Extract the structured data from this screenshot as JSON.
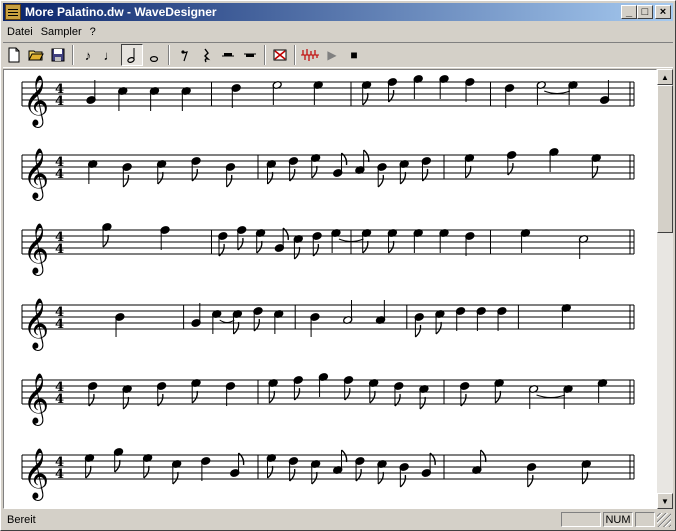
{
  "window": {
    "title": "More Palatino.dw - WaveDesigner"
  },
  "title_buttons": {
    "minimize": "_",
    "maximize": "□",
    "close": "×"
  },
  "menu": [
    {
      "label": "Datei"
    },
    {
      "label": "Sampler"
    },
    {
      "label": "?"
    }
  ],
  "toolbar": {
    "new": "new-file-icon",
    "open": "open-folder-icon",
    "save": "save-disk-icon",
    "eighth_note": "♪",
    "quarter_note": "♩",
    "half_note": "𝅗𝅥",
    "whole_note": "𝅝",
    "eighth_rest": "𝄾",
    "quarter_rest": "𝄽",
    "half_rest": "half-rest-icon",
    "whole_rest": "whole-rest-icon",
    "delete": "delete-note-icon",
    "waveform": "waveform-icon",
    "play": "▶",
    "stop": "■"
  },
  "score": {
    "clef": "𝄞",
    "time_top": "4",
    "time_bottom": "4",
    "rows": [
      {
        "measures": [
          [
            {
              "p": "G4",
              "d": "q"
            },
            {
              "p": "C5",
              "d": "q"
            },
            {
              "p": "C5",
              "d": "q"
            },
            {
              "p": "C5",
              "d": "q"
            }
          ],
          [
            {
              "p": "D5",
              "d": "q"
            },
            {
              "p": "E5",
              "d": "h"
            },
            {
              "p": "E5",
              "d": "q"
            }
          ],
          [
            {
              "p": "E5",
              "d": "e"
            },
            {
              "p": "F5",
              "d": "e"
            },
            {
              "p": "G5",
              "d": "q"
            },
            {
              "p": "G5",
              "d": "q"
            },
            {
              "p": "F5",
              "d": "q"
            }
          ],
          [
            {
              "p": "D5",
              "d": "q"
            },
            {
              "p": "E5",
              "d": "h",
              "tie": true
            },
            {
              "p": "E5",
              "d": "q"
            },
            {
              "p": "G4",
              "d": "q"
            }
          ]
        ]
      },
      {
        "measures": [
          [
            {
              "p": "C5",
              "d": "q"
            },
            {
              "p": "B4",
              "d": "e"
            },
            {
              "p": "C5",
              "d": "e"
            },
            {
              "p": "D5",
              "d": "e"
            },
            {
              "p": "B4",
              "d": "e"
            }
          ],
          [
            {
              "p": "C5",
              "d": "e"
            },
            {
              "p": "D5",
              "d": "e"
            },
            {
              "p": "E5",
              "d": "e"
            },
            {
              "p": "G4",
              "d": "e"
            },
            {
              "p": "A4",
              "d": "e"
            },
            {
              "p": "B4",
              "d": "e"
            },
            {
              "p": "C5",
              "d": "e"
            },
            {
              "p": "D5",
              "d": "e"
            }
          ],
          [
            {
              "p": "E5",
              "d": "e"
            },
            {
              "p": "F5",
              "d": "e"
            },
            {
              "p": "G5",
              "d": "q"
            },
            {
              "p": "E5",
              "d": "e"
            }
          ]
        ]
      },
      {
        "measures": [
          [
            {
              "p": "G5",
              "d": "e"
            },
            {
              "p": "F5",
              "d": "q"
            }
          ],
          [
            {
              "p": "D5",
              "d": "e"
            },
            {
              "p": "F5",
              "d": "e"
            },
            {
              "p": "E5",
              "d": "e"
            },
            {
              "p": "G4",
              "d": "e"
            },
            {
              "p": "C5",
              "d": "e"
            },
            {
              "p": "D5",
              "d": "e"
            },
            {
              "p": "E5",
              "d": "q",
              "tie": true
            }
          ],
          [
            {
              "p": "E5",
              "d": "e"
            },
            {
              "p": "E5",
              "d": "e"
            },
            {
              "p": "E5",
              "d": "q"
            },
            {
              "p": "E5",
              "d": "q"
            },
            {
              "p": "D5",
              "d": "q"
            }
          ],
          [
            {
              "p": "E5",
              "d": "q"
            },
            {
              "p": "C5",
              "d": "h"
            }
          ]
        ]
      },
      {
        "measures": [
          [
            {
              "p": "B4",
              "d": "q"
            }
          ],
          [
            {
              "p": "G4",
              "d": "q"
            },
            {
              "p": "C5",
              "d": "q",
              "tie": true
            },
            {
              "p": "C5",
              "d": "e"
            },
            {
              "p": "D5",
              "d": "e"
            },
            {
              "p": "C5",
              "d": "q"
            }
          ],
          [
            {
              "p": "B4",
              "d": "q"
            },
            {
              "p": "A4",
              "d": "h"
            },
            {
              "p": "A4",
              "d": "q"
            }
          ],
          [
            {
              "p": "B4",
              "d": "e"
            },
            {
              "p": "C5",
              "d": "e"
            },
            {
              "p": "D5",
              "d": "q"
            },
            {
              "p": "D5",
              "d": "q"
            },
            {
              "p": "D5",
              "d": "q"
            }
          ],
          [
            {
              "p": "E5",
              "d": "q"
            }
          ]
        ]
      },
      {
        "measures": [
          [
            {
              "p": "D5",
              "d": "e"
            },
            {
              "p": "C5",
              "d": "e"
            },
            {
              "p": "D5",
              "d": "e"
            },
            {
              "p": "E5",
              "d": "e"
            },
            {
              "p": "D5",
              "d": "q"
            }
          ],
          [
            {
              "p": "E5",
              "d": "e"
            },
            {
              "p": "F5",
              "d": "e"
            },
            {
              "p": "G5",
              "d": "q"
            },
            {
              "p": "F5",
              "d": "e"
            },
            {
              "p": "E5",
              "d": "e"
            },
            {
              "p": "D5",
              "d": "e"
            },
            {
              "p": "C5",
              "d": "e"
            }
          ],
          [
            {
              "p": "D5",
              "d": "e"
            },
            {
              "p": "E5",
              "d": "e"
            },
            {
              "p": "C5",
              "d": "h",
              "tie": true
            },
            {
              "p": "C5",
              "d": "q"
            },
            {
              "p": "E5",
              "d": "q"
            }
          ]
        ]
      },
      {
        "measures": [
          [
            {
              "p": "E5",
              "d": "e"
            },
            {
              "p": "G5",
              "d": "e"
            },
            {
              "p": "E5",
              "d": "e"
            },
            {
              "p": "C5",
              "d": "e"
            },
            {
              "p": "D5",
              "d": "q"
            },
            {
              "p": "G4",
              "d": "e"
            }
          ],
          [
            {
              "p": "E5",
              "d": "e"
            },
            {
              "p": "D5",
              "d": "e"
            },
            {
              "p": "C5",
              "d": "e"
            },
            {
              "p": "A4",
              "d": "e"
            },
            {
              "p": "D5",
              "d": "e"
            },
            {
              "p": "C5",
              "d": "e"
            },
            {
              "p": "B4",
              "d": "e"
            },
            {
              "p": "G4",
              "d": "e"
            }
          ],
          [
            {
              "p": "A4",
              "d": "e"
            },
            {
              "p": "B4",
              "d": "e"
            },
            {
              "p": "C5",
              "d": "e"
            }
          ]
        ]
      }
    ]
  },
  "status": {
    "text": "Bereit",
    "num": "NUM"
  }
}
